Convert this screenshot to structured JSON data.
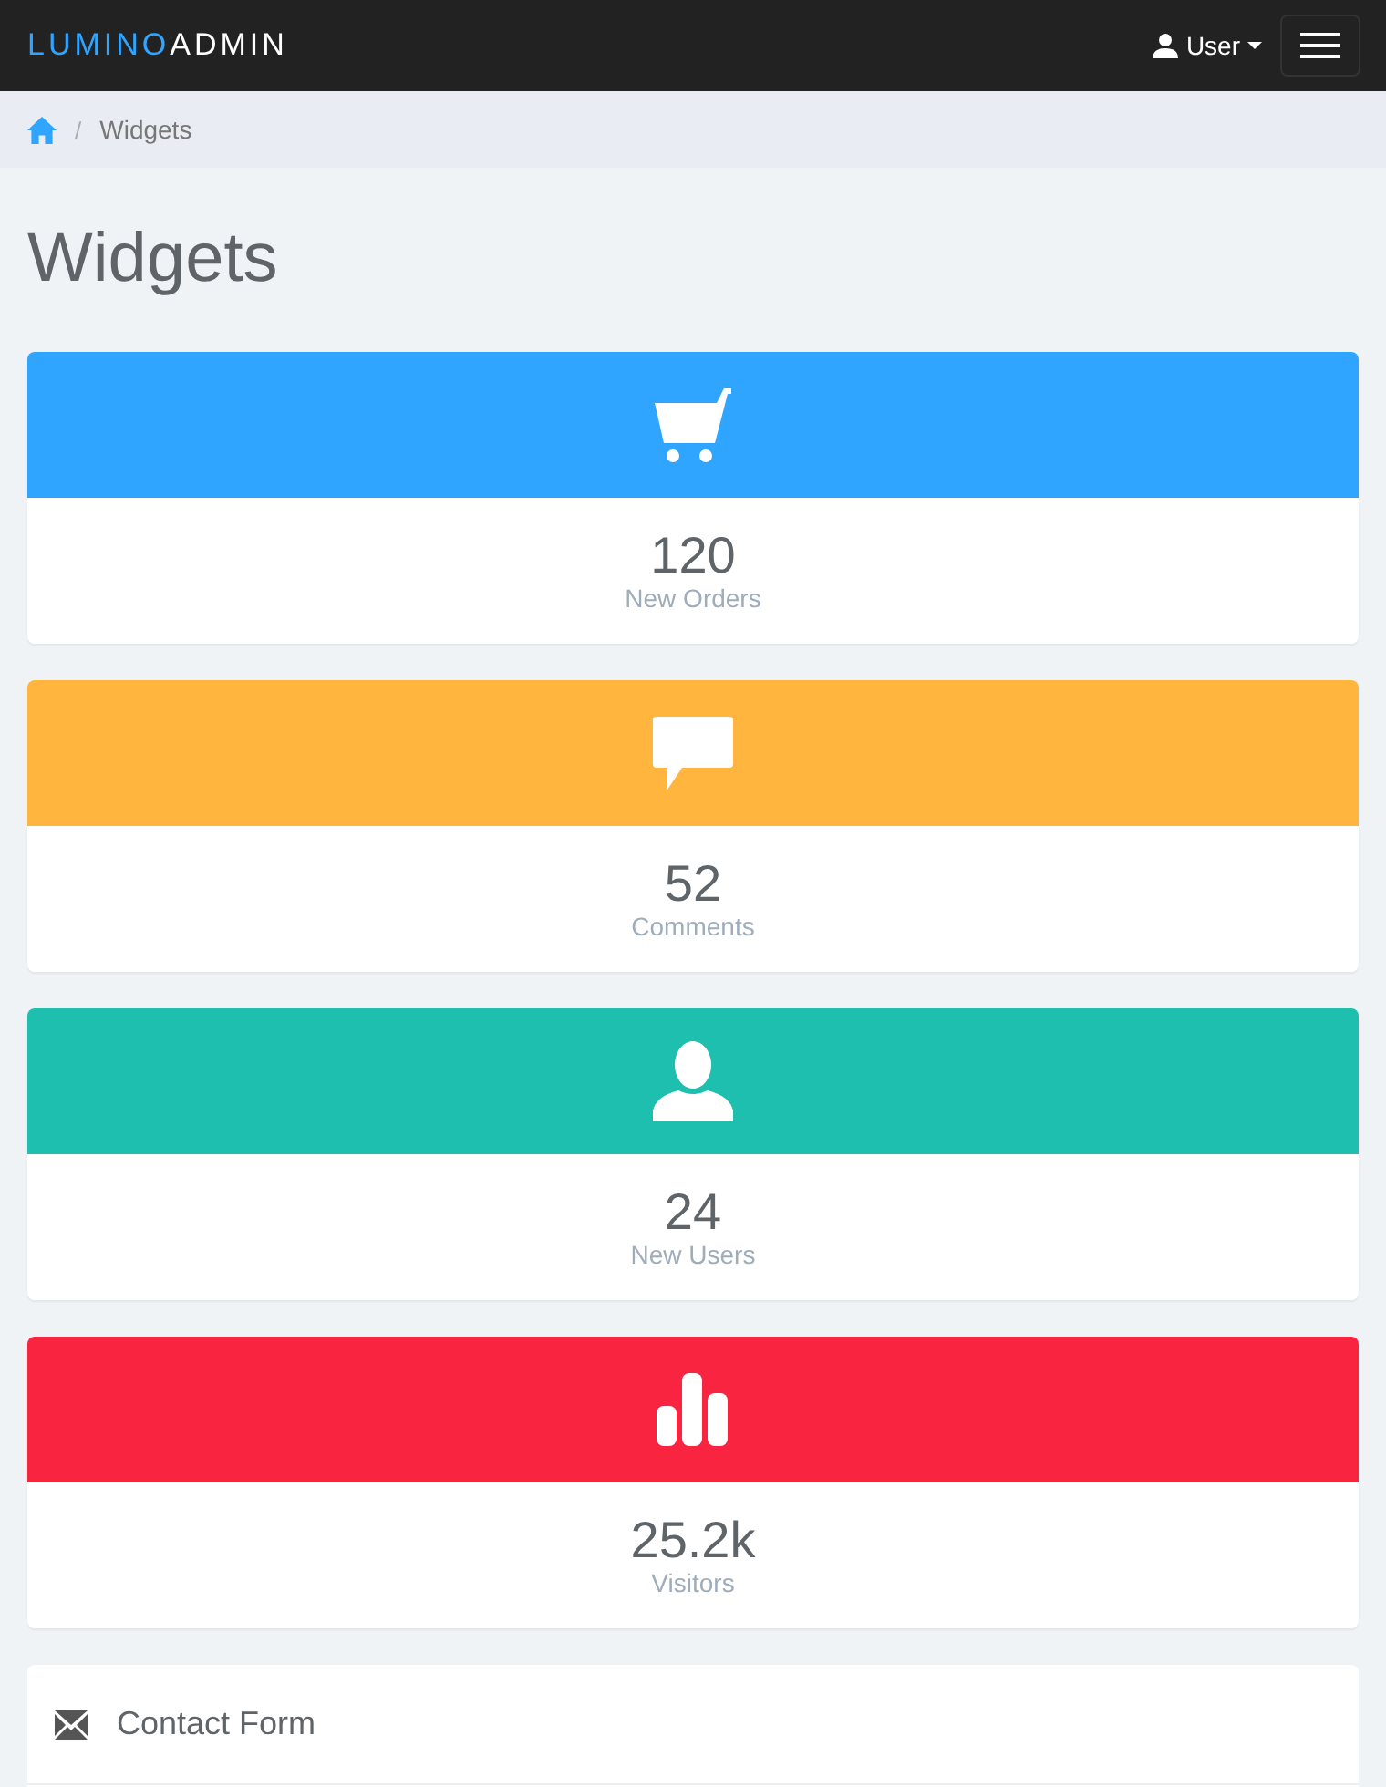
{
  "navbar": {
    "brand_primary": "LUMINO",
    "brand_secondary": "ADMIN",
    "user_menu": "User"
  },
  "breadcrumb": {
    "separator": "/",
    "current": "Widgets"
  },
  "page_title": "Widgets",
  "widgets": [
    {
      "kind": "cart",
      "color": "#30a5ff",
      "value": "120",
      "label": "New Orders"
    },
    {
      "kind": "comment",
      "color": "#ffb53e",
      "value": "52",
      "label": "Comments"
    },
    {
      "kind": "user",
      "color": "#1ebfae",
      "value": "24",
      "label": "New Users"
    },
    {
      "kind": "chart",
      "color": "#f9243f",
      "value": "25.2k",
      "label": "Visitors"
    }
  ],
  "contact_panel": {
    "title": "Contact Form"
  }
}
